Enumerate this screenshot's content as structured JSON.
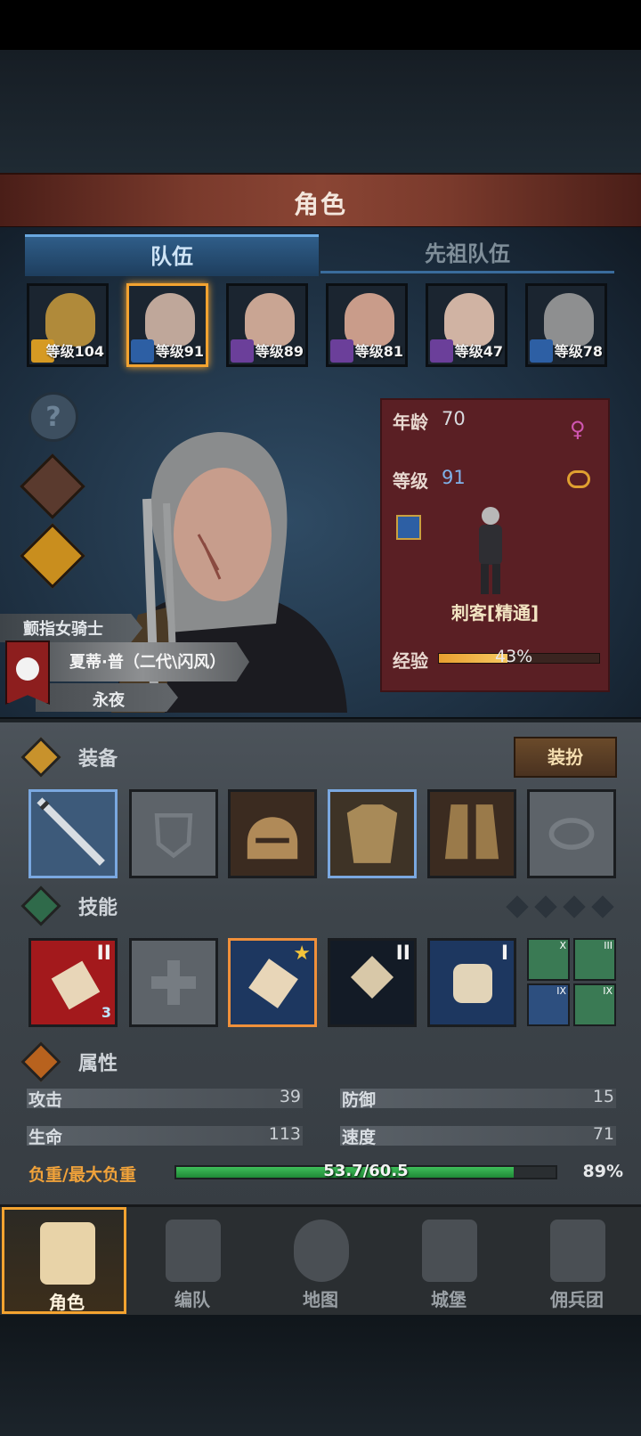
{
  "title": "角色",
  "tabs": [
    {
      "label": "队伍"
    },
    {
      "label": "先祖队伍"
    }
  ],
  "team": [
    {
      "level": "等级104",
      "face_color": "#b08a3a",
      "class_color": "#d69a23"
    },
    {
      "level": "等级91",
      "face_color": "#bfa79a",
      "class_color": "#2d5fa4"
    },
    {
      "level": "等级89",
      "face_color": "#c9a593",
      "class_color": "#6b3f9a"
    },
    {
      "level": "等级81",
      "face_color": "#c99c8a",
      "class_color": "#6b3f9a"
    },
    {
      "level": "等级47",
      "face_color": "#d0b3a3",
      "class_color": "#6b3f9a"
    },
    {
      "level": "等级78",
      "face_color": "#8e8f90",
      "class_color": "#2d5fa4"
    }
  ],
  "side_icons": [
    "help-icon",
    "hooded-figure-icon",
    "potion-icon"
  ],
  "hero": {
    "title_label": "颤指女骑士",
    "name": "夏蒂·普（二代\\闪风）",
    "trait": "永夜",
    "age_label": "年龄",
    "age": "70",
    "level_label": "等级",
    "level": "91",
    "class": "刺客[精通]",
    "exp_label": "经验",
    "exp_percent": "43%",
    "exp_fraction": 0.43
  },
  "equipment": {
    "label": "装备",
    "dress_button": "装扮",
    "slots": [
      {
        "name": "dagger",
        "color": "#3d5a7a",
        "filled": true,
        "selected": true
      },
      {
        "name": "shield",
        "color": "#5d6369",
        "filled": false,
        "selected": false
      },
      {
        "name": "helmet",
        "color": "#3b2b20",
        "filled": true,
        "selected": false
      },
      {
        "name": "armor",
        "color": "#3e3326",
        "filled": true,
        "selected": true
      },
      {
        "name": "boots",
        "color": "#3b2b20",
        "filled": true,
        "selected": false
      },
      {
        "name": "ring",
        "color": "#5d6369",
        "filled": false,
        "selected": false
      }
    ]
  },
  "skills": {
    "label": "技能",
    "slots": [
      {
        "rank": "II",
        "color": "#a3191c",
        "badge": "3"
      },
      {
        "rank": "",
        "color": "#5d6369",
        "badge": ""
      },
      {
        "rank": "",
        "color": "#1d3760",
        "badge": ""
      },
      {
        "rank": "II",
        "color": "#131b26",
        "badge": ""
      },
      {
        "rank": "I",
        "color": "#1d3760",
        "badge": ""
      }
    ],
    "mini": [
      {
        "rank": "X",
        "color": "#3a7a54"
      },
      {
        "rank": "III",
        "color": "#3a7a54"
      },
      {
        "rank": "IX",
        "color": "#2d4f7f"
      },
      {
        "rank": "IX",
        "color": "#3a7a54"
      }
    ]
  },
  "attributes": {
    "label": "属性",
    "attack_label": "攻击",
    "attack": "39",
    "defense_label": "防御",
    "defense": "15",
    "hp_label": "生命",
    "hp": "113",
    "speed_label": "速度",
    "speed": "71",
    "load_label": "负重/最大负重",
    "load_value": "53.7/60.5",
    "load_percent": "89%",
    "load_fraction": 0.89
  },
  "nav": [
    {
      "label": "角色",
      "active": true
    },
    {
      "label": "编队",
      "active": false
    },
    {
      "label": "地图",
      "active": false
    },
    {
      "label": "城堡",
      "active": false
    },
    {
      "label": "佣兵团",
      "active": false
    }
  ]
}
